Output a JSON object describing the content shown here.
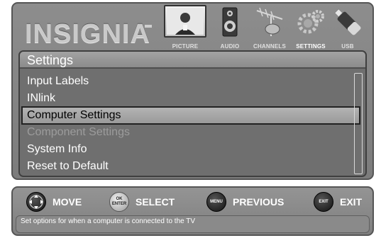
{
  "brand": {
    "logo": "INSIGNIA"
  },
  "tabs": [
    {
      "label": "PICTURE",
      "icon": "tv-icon",
      "active": false
    },
    {
      "label": "AUDIO",
      "icon": "speaker-icon",
      "active": false
    },
    {
      "label": "CHANNELS",
      "icon": "antenna-icon",
      "active": false
    },
    {
      "label": "SETTINGS",
      "icon": "gears-icon",
      "active": true
    },
    {
      "label": "USB",
      "icon": "usb-drive-icon",
      "active": false
    }
  ],
  "settings": {
    "title": "Settings",
    "items": [
      {
        "label": "Input Labels",
        "state": "normal"
      },
      {
        "label": "INlink",
        "state": "normal"
      },
      {
        "label": "Computer Settings",
        "state": "selected"
      },
      {
        "label": "Component Settings",
        "state": "disabled"
      },
      {
        "label": "System Info",
        "state": "normal"
      },
      {
        "label": "Reset to Default",
        "state": "normal"
      }
    ]
  },
  "nav": {
    "move": {
      "label": "MOVE",
      "icon": "dpad-icon"
    },
    "select": {
      "label": "SELECT",
      "button_text": "OK\nENTER",
      "icon": "ok-enter-icon"
    },
    "previous": {
      "label": "PREVIOUS",
      "button_text": "MENU",
      "icon": "menu-button-icon"
    },
    "exit": {
      "label": "EXIT",
      "button_text": "EXIT",
      "icon": "exit-button-icon"
    }
  },
  "help_text": "Set options for when a computer is connected to the TV",
  "colors": {
    "panel": "#858585",
    "list_bg": "#6f6f6f",
    "selected_bg": "#a8a8a8",
    "disabled_text": "#9c9c9c",
    "text": "#ffffff"
  }
}
